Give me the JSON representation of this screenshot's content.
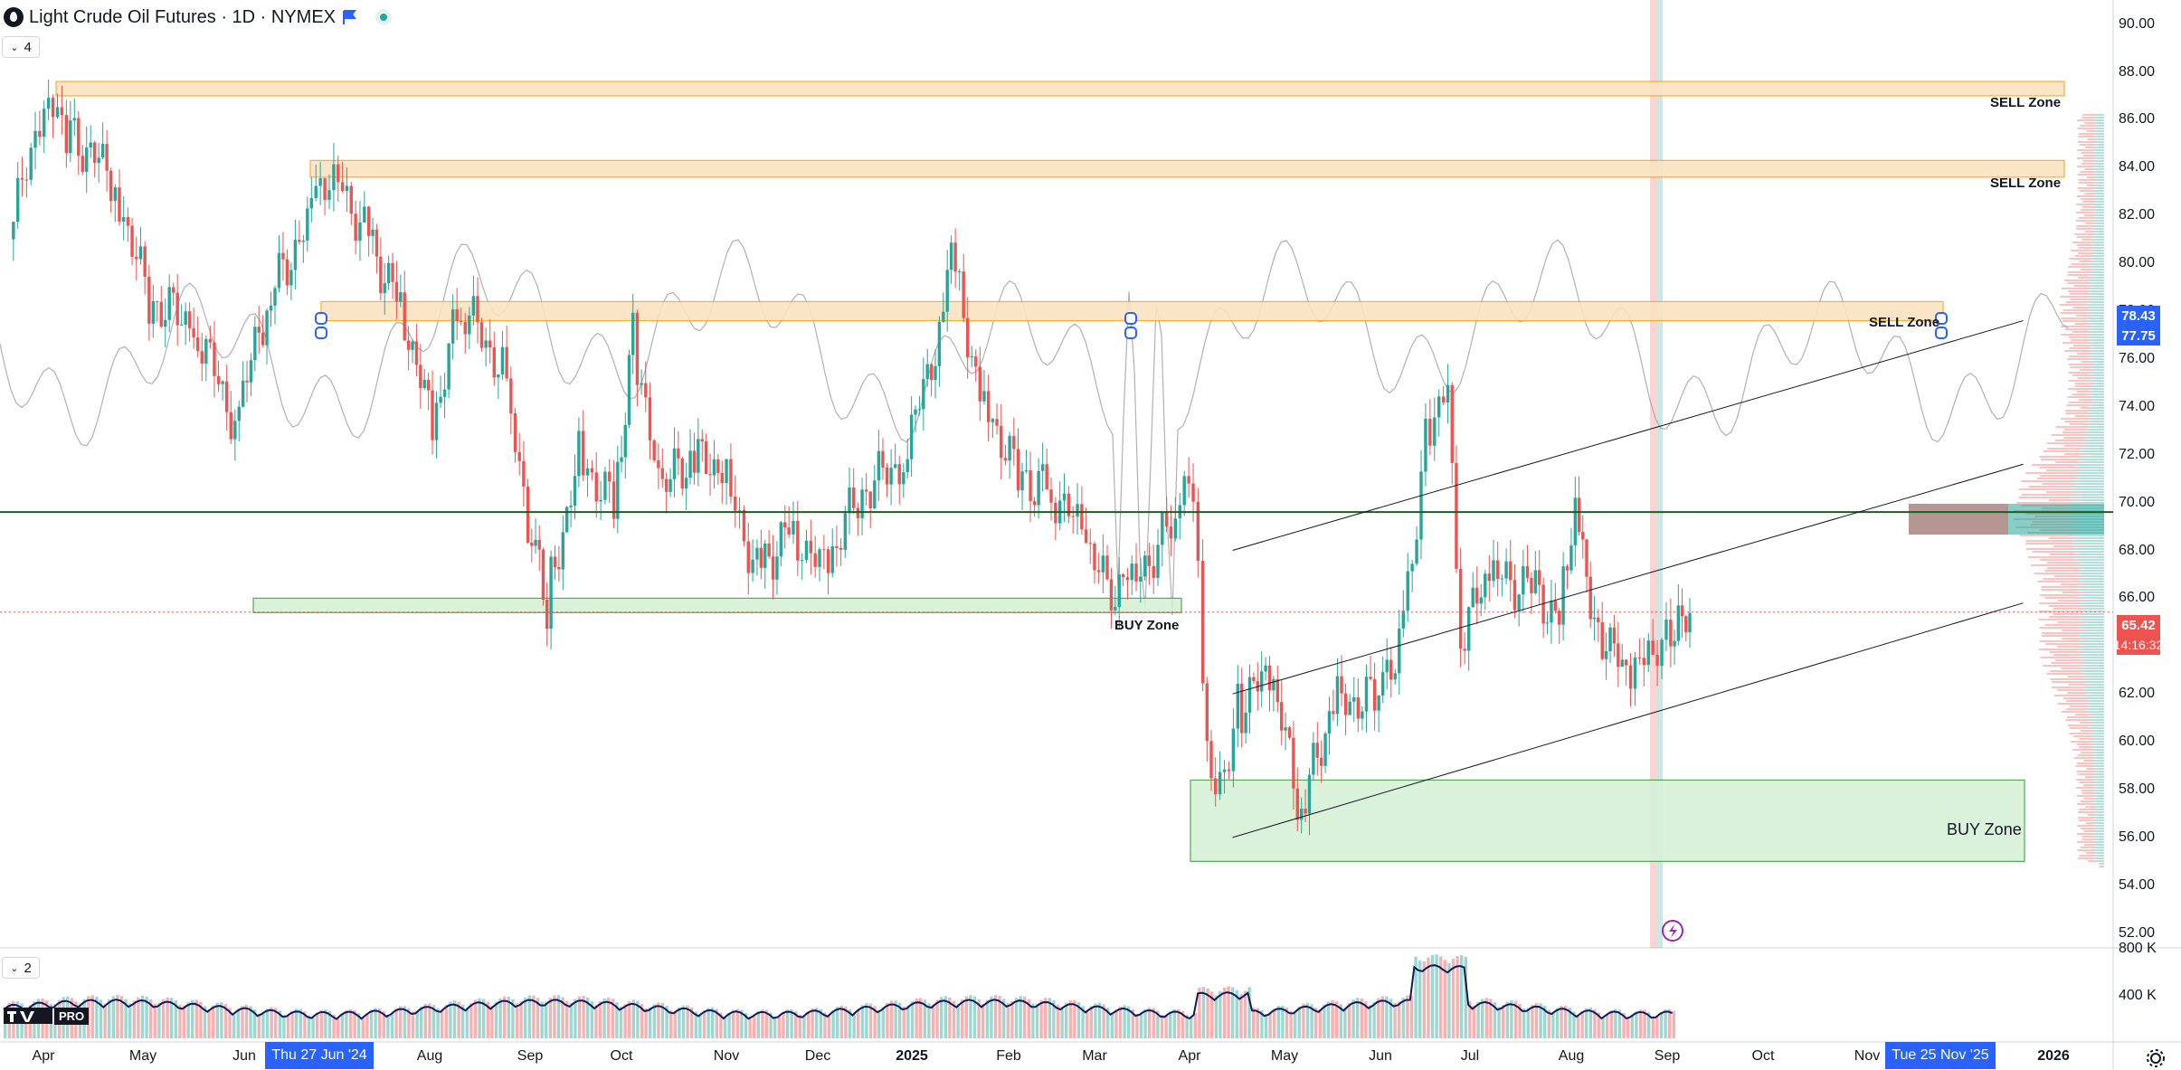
{
  "header": {
    "title": "Light Crude Oil Futures · 1D · NYMEX",
    "pane1_count": "4",
    "pane2_count": "2"
  },
  "price_axis": {
    "ticks": [
      "90.00",
      "88.00",
      "86.00",
      "84.00",
      "82.00",
      "80.00",
      "78.00",
      "76.00",
      "74.00",
      "72.00",
      "70.00",
      "68.00",
      "66.00",
      "64.00",
      "62.00",
      "60.00",
      "58.00",
      "56.00",
      "54.00",
      "52.00"
    ],
    "tags": {
      "upper": "78.43",
      "lower": "77.75",
      "last_price": "65.42",
      "countdown": "14:16:32"
    }
  },
  "volume_axis": {
    "ticks": [
      "800 K",
      "400 K"
    ]
  },
  "time_axis": {
    "labels": [
      {
        "text": "Apr",
        "bold": false
      },
      {
        "text": "May",
        "bold": false
      },
      {
        "text": "Jun",
        "bold": false
      },
      {
        "text": "Aug",
        "bold": false
      },
      {
        "text": "Sep",
        "bold": false
      },
      {
        "text": "Oct",
        "bold": false
      },
      {
        "text": "Nov",
        "bold": false
      },
      {
        "text": "Dec",
        "bold": false
      },
      {
        "text": "2025",
        "bold": true
      },
      {
        "text": "Feb",
        "bold": false
      },
      {
        "text": "Mar",
        "bold": false
      },
      {
        "text": "Apr",
        "bold": false
      },
      {
        "text": "May",
        "bold": false
      },
      {
        "text": "Jun",
        "bold": false
      },
      {
        "text": "Jul",
        "bold": false
      },
      {
        "text": "Aug",
        "bold": false
      },
      {
        "text": "Sep",
        "bold": false
      },
      {
        "text": "Oct",
        "bold": false
      },
      {
        "text": "Nov",
        "bold": false
      },
      {
        "text": "2026",
        "bold": true
      }
    ],
    "highlight_left": "Thu 27 Jun '24",
    "highlight_right": "Tue 25 Nov '25"
  },
  "zones": {
    "sell_1": "SELL Zone",
    "sell_2": "SELL Zone",
    "sell_3": "SELL Zone",
    "buy_small": "BUY Zone",
    "buy_big": "BUY Zone"
  },
  "logo_text": "PRO",
  "colors": {
    "up": "#26a69a",
    "down": "#ef5350",
    "sell_zone_fill": "#fbe3c2",
    "sell_zone_border": "#f5a623",
    "buy_zone_fill": "#d7f0d7",
    "buy_zone_border": "#43a047",
    "accent": "#2962ff",
    "hline": "#1b5e20"
  },
  "chart_data": {
    "type": "candlestick",
    "symbol": "Light Crude Oil Futures",
    "interval": "1D",
    "exchange": "NYMEX",
    "ylim": [
      52,
      90
    ],
    "last_price": 65.42,
    "horizontal_line": 69.6,
    "sell_zones": [
      [
        87.0,
        87.6
      ],
      [
        83.6,
        84.3
      ],
      [
        77.6,
        78.4
      ]
    ],
    "buy_zones": [
      [
        65.4,
        66.0
      ],
      [
        55.0,
        58.4
      ]
    ],
    "channel_lines": [
      {
        "from": [
          "2025-04-02",
          68.0
        ],
        "to": [
          "2025-11-25",
          77.6
        ]
      },
      {
        "from": [
          "2025-04-02",
          62.0
        ],
        "to": [
          "2025-11-25",
          71.6
        ]
      },
      {
        "from": [
          "2025-04-02",
          56.0
        ],
        "to": [
          "2025-11-25",
          65.8
        ]
      }
    ],
    "close_path": [
      [
        "2024-03-25",
        81.0
      ],
      [
        "2024-04-05",
        86.9
      ],
      [
        "2024-04-12",
        85.5
      ],
      [
        "2024-04-26",
        83.8
      ],
      [
        "2024-05-08",
        78.4
      ],
      [
        "2024-05-22",
        77.6
      ],
      [
        "2024-06-04",
        73.3
      ],
      [
        "2024-06-14",
        78.4
      ],
      [
        "2024-06-28",
        81.9
      ],
      [
        "2024-07-05",
        83.9
      ],
      [
        "2024-07-16",
        80.9
      ],
      [
        "2024-07-26",
        78.3
      ],
      [
        "2024-08-05",
        73.2
      ],
      [
        "2024-08-14",
        78.4
      ],
      [
        "2024-08-27",
        75.5
      ],
      [
        "2024-09-04",
        69.2
      ],
      [
        "2024-09-10",
        65.8
      ],
      [
        "2024-09-20",
        71.9
      ],
      [
        "2024-10-01",
        69.8
      ],
      [
        "2024-10-07",
        77.1
      ],
      [
        "2024-10-15",
        70.6
      ],
      [
        "2024-10-25",
        71.8
      ],
      [
        "2024-11-04",
        71.5
      ],
      [
        "2024-11-15",
        67.0
      ],
      [
        "2024-11-25",
        68.9
      ],
      [
        "2024-12-06",
        67.2
      ],
      [
        "2024-12-18",
        70.6
      ],
      [
        "2024-12-31",
        71.7
      ],
      [
        "2025-01-10",
        76.6
      ],
      [
        "2025-01-15",
        80.0
      ],
      [
        "2025-01-24",
        74.7
      ],
      [
        "2025-02-05",
        71.0
      ],
      [
        "2025-02-14",
        70.7
      ],
      [
        "2025-02-25",
        68.9
      ],
      [
        "2025-03-05",
        66.3
      ],
      [
        "2025-03-10",
        66.0
      ],
      [
        "2025-03-25",
        69.0
      ],
      [
        "2025-04-01",
        71.2
      ],
      [
        "2025-04-04",
        61.9
      ],
      [
        "2025-04-08",
        57.6
      ],
      [
        "2025-04-15",
        61.3
      ],
      [
        "2025-04-25",
        63.0
      ],
      [
        "2025-05-05",
        57.1
      ],
      [
        "2025-05-15",
        61.6
      ],
      [
        "2025-05-28",
        61.8
      ],
      [
        "2025-06-06",
        64.6
      ],
      [
        "2025-06-13",
        72.9
      ],
      [
        "2025-06-20",
        75.0
      ],
      [
        "2025-06-24",
        64.4
      ],
      [
        "2025-07-03",
        67.0
      ],
      [
        "2025-07-15",
        66.5
      ],
      [
        "2025-07-25",
        65.2
      ],
      [
        "2025-07-30",
        70.0
      ],
      [
        "2025-08-05",
        65.2
      ],
      [
        "2025-08-15",
        62.8
      ],
      [
        "2025-08-22",
        63.7
      ],
      [
        "2025-08-29",
        64.0
      ],
      [
        "2025-09-04",
        65.42
      ]
    ]
  }
}
